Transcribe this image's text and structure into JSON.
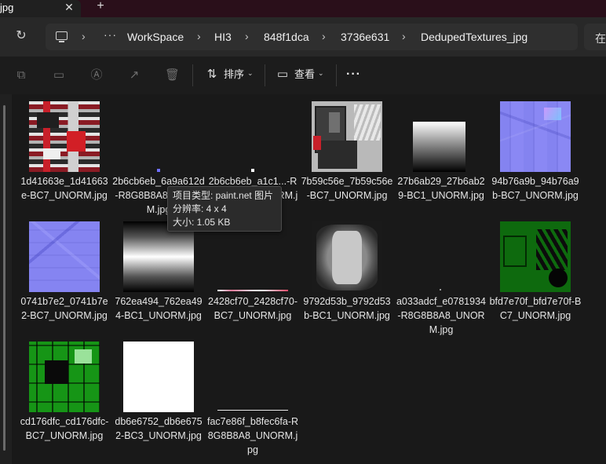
{
  "tab": {
    "title": "jpg",
    "close": "✕",
    "new": "+"
  },
  "address": {
    "refresh": "↻",
    "more": "···",
    "crumbs": [
      "WorkSpace",
      "HI3",
      "848f1dca",
      "3736e631",
      "DedupedTextures_jpg"
    ],
    "search_prefix": "在"
  },
  "commands": {
    "sort_label": "排序",
    "view_label": "查看",
    "more": "···"
  },
  "tooltip": {
    "type": "项目类型: paint.net 图片",
    "size_dim": "分辨率: 4 x 4",
    "file_size": "大小: 1.05 KB"
  },
  "files": [
    {
      "name": "1d41663e_1d41663e-BC7_UNORM.jpg",
      "thumb": "red"
    },
    {
      "name": "2b6cb6eb_6a9a612d-R8G8B8A8_UNORM.jpg",
      "thumb": "dot-blue"
    },
    {
      "name": "2b6cb6eb_a1c1...-R8G8B8A8_UNORM.jpg",
      "thumb": "dot-white"
    },
    {
      "name": "7b59c56e_7b59c56e-BC7_UNORM.jpg",
      "thumb": "mech"
    },
    {
      "name": "27b6ab29_27b6ab29-BC1_UNORM.jpg",
      "thumb": "grad-v"
    },
    {
      "name": "94b76a9b_94b76a9b-BC7_UNORM.jpg",
      "thumb": "normal"
    },
    {
      "name": "0741b7e2_0741b7e2-BC7_UNORM.jpg",
      "thumb": "normal2"
    },
    {
      "name": "762ea494_762ea494-BC1_UNORM.jpg",
      "thumb": "hband"
    },
    {
      "name": "2428cf70_2428cf70-BC7_UNORM.jpg",
      "thumb": "line-red"
    },
    {
      "name": "9792d53b_9792d53b-BC1_UNORM.jpg",
      "thumb": "lens"
    },
    {
      "name": "a033adcf_e0781934-R8G8B8A8_UNORM.jpg",
      "thumb": "dot-gray"
    },
    {
      "name": "bfd7e70f_bfd7e70f-BC7_UNORM.jpg",
      "thumb": "green"
    },
    {
      "name": "cd176dfc_cd176dfc-BC7_UNORM.jpg",
      "thumb": "green2"
    },
    {
      "name": "db6e6752_db6e6752-BC3_UNORM.jpg",
      "thumb": "white"
    },
    {
      "name": "fac7e86f_b8fec6fa-R8G8B8A8_UNORM.jpg",
      "thumb": "line-white"
    }
  ],
  "colors": {
    "tabbar": "#2a0f1a",
    "background": "#191919",
    "accent": "#ffffff"
  }
}
